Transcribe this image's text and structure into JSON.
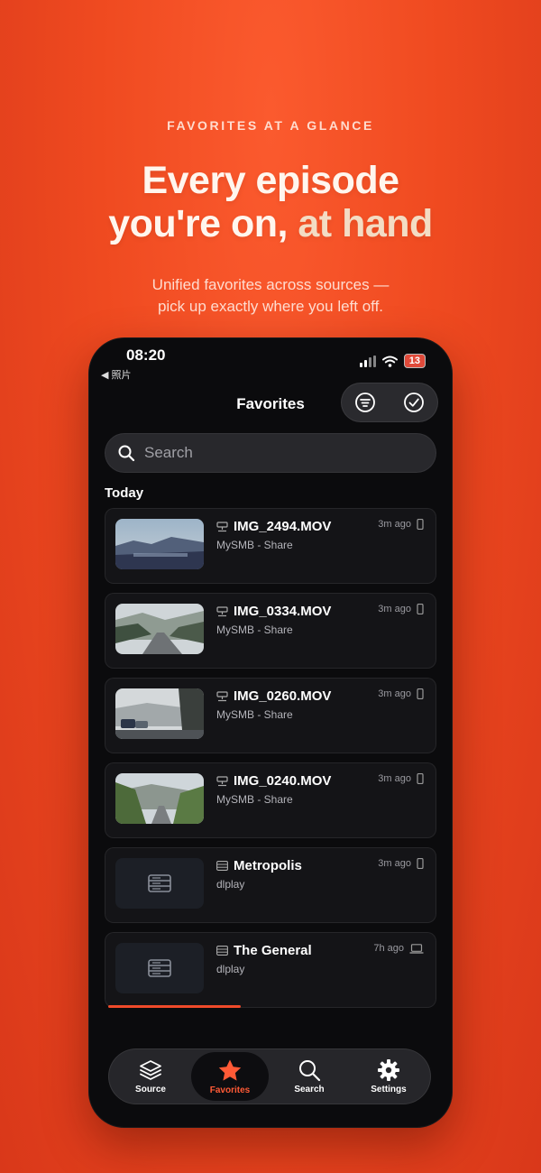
{
  "hero": {
    "eyebrow": "FAVORITES AT A GLANCE",
    "headline_line1": "Every episode",
    "headline_line2_pre": "you're on, ",
    "headline_accent": "at hand",
    "subtitle_line1": "Unified favorites across sources —",
    "subtitle_line2": "pick up exactly where you left off."
  },
  "status_bar": {
    "time": "08:20",
    "back_label": "◀ 照片",
    "battery": "13"
  },
  "nav": {
    "title": "Favorites"
  },
  "search": {
    "placeholder": "Search"
  },
  "section": {
    "label": "Today"
  },
  "items": [
    {
      "title": "IMG_2494.MOV",
      "subtitle": "MySMB - Share",
      "time": "3m ago",
      "source_icon": "network-drive-icon",
      "device_icon": "phone-icon"
    },
    {
      "title": "IMG_0334.MOV",
      "subtitle": "MySMB - Share",
      "time": "3m ago",
      "source_icon": "network-drive-icon",
      "device_icon": "phone-icon"
    },
    {
      "title": "IMG_0260.MOV",
      "subtitle": "MySMB - Share",
      "time": "3m ago",
      "source_icon": "network-drive-icon",
      "device_icon": "phone-icon"
    },
    {
      "title": "IMG_0240.MOV",
      "subtitle": "MySMB - Share",
      "time": "3m ago",
      "source_icon": "network-drive-icon",
      "device_icon": "phone-icon"
    },
    {
      "title": "Metropolis",
      "subtitle": "dlplay",
      "time": "3m ago",
      "source_icon": "server-icon",
      "device_icon": "phone-icon"
    },
    {
      "title": "The General",
      "subtitle": "dlplay",
      "time": "7h ago",
      "source_icon": "server-icon",
      "device_icon": "laptop-icon",
      "progress": 0.4
    }
  ],
  "tabs": [
    {
      "label": "Source",
      "icon": "layers-icon"
    },
    {
      "label": "Favorites",
      "icon": "star-icon",
      "active": true
    },
    {
      "label": "Search",
      "icon": "search-icon"
    },
    {
      "label": "Settings",
      "icon": "gear-icon"
    }
  ],
  "colors": {
    "accent": "#ef4a2a",
    "background": "#ef4a20",
    "phone_bg": "#0b0b0d"
  }
}
